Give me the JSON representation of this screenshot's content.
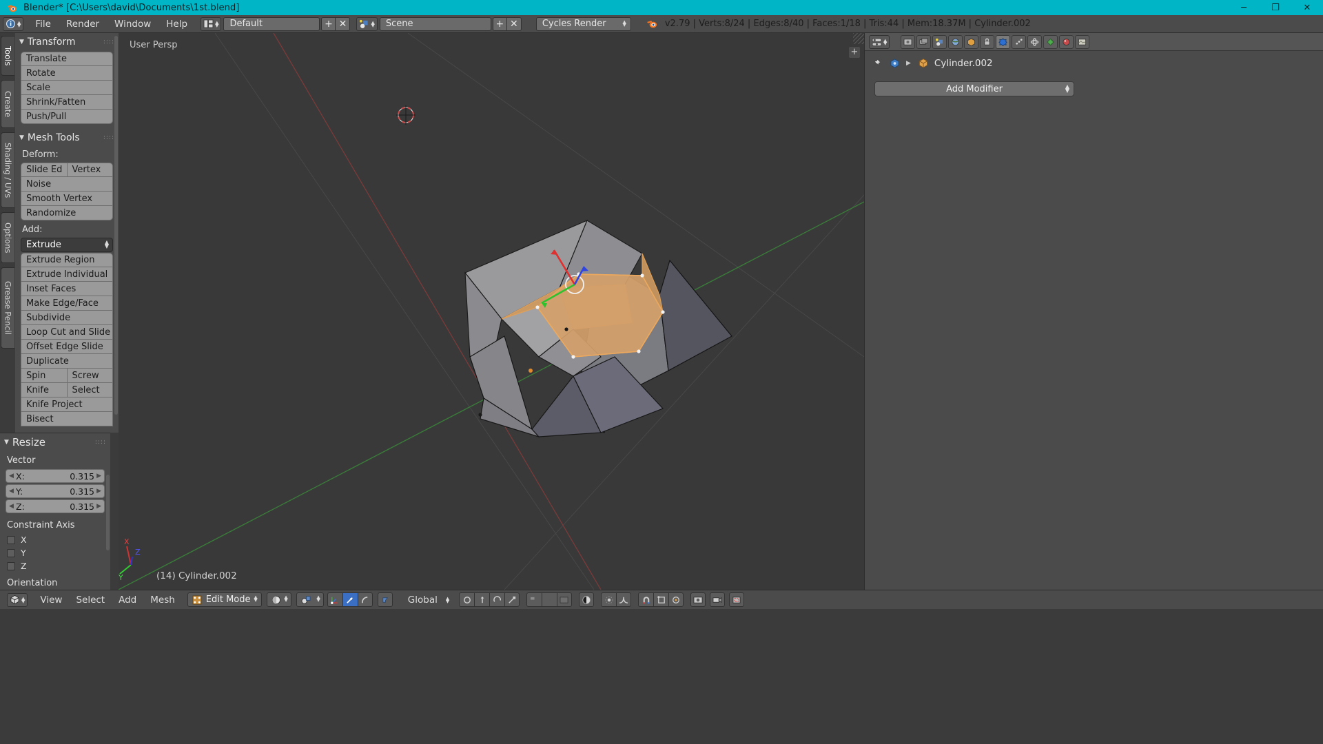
{
  "window": {
    "title": "Blender* [C:\\Users\\david\\Documents\\1st.blend]",
    "icon": "blender-logo-icon",
    "minimize": "─",
    "maximize": "❐",
    "close": "✕"
  },
  "topbar": {
    "editor_type_icon": "info-editor-icon",
    "menus": [
      "File",
      "Render",
      "Window",
      "Help"
    ],
    "screen_layout_icon": "screen-layout-icon",
    "screen_layout": "Default",
    "screen_add": "+",
    "screen_remove": "✕",
    "scene_icon": "scene-icon",
    "scene": "Scene",
    "scene_add": "+",
    "scene_remove": "✕",
    "render_engine": "Cycles Render",
    "blender_icon": "blender-logo-icon",
    "status": "v2.79 | Verts:8/24 | Edges:8/40 | Faces:1/18 | Tris:44 | Mem:18.37M | Cylinder.002"
  },
  "toolshelf": {
    "tabs": [
      {
        "label": "Tools",
        "active": true
      },
      {
        "label": "Create",
        "active": false
      },
      {
        "label": "Shading / UVs",
        "active": false
      },
      {
        "label": "Options",
        "active": false
      },
      {
        "label": "Grease Pencil",
        "active": false
      }
    ],
    "transform": {
      "title": "Transform",
      "buttons": [
        "Translate",
        "Rotate",
        "Scale",
        "Shrink/Fatten",
        "Push/Pull"
      ]
    },
    "mesh_tools": {
      "title": "Mesh Tools",
      "deform_label": "Deform:",
      "deform_pair": [
        "Slide Ed",
        "Vertex"
      ],
      "deform_buttons": [
        "Noise",
        "Smooth Vertex",
        "Randomize"
      ],
      "add_label": "Add:",
      "add_dropdown": "Extrude",
      "add_buttons": [
        "Extrude Region",
        "Extrude Individual",
        "Inset Faces",
        "Make Edge/Face",
        "Subdivide",
        "Loop Cut and Slide",
        "Offset Edge Slide",
        "Duplicate"
      ],
      "pair_spin": [
        "Spin",
        "Screw"
      ],
      "pair_knife": [
        "Knife",
        "Select"
      ],
      "tail_buttons": [
        "Knife Project",
        "Bisect"
      ]
    }
  },
  "operator_panel": {
    "title": "Resize",
    "vector_label": "Vector",
    "fields": [
      {
        "label": "X:",
        "value": "0.315"
      },
      {
        "label": "Y:",
        "value": "0.315"
      },
      {
        "label": "Z:",
        "value": "0.315"
      }
    ],
    "constraint_axis_label": "Constraint Axis",
    "axes": [
      "X",
      "Y",
      "Z"
    ],
    "orientation_label": "Orientation"
  },
  "viewport": {
    "perspective_label": "User Persp",
    "object_label": "(14) Cylinder.002",
    "axis_gizmo": {
      "x": "X",
      "y": "Y",
      "z": "Z"
    },
    "add_overlay": "+",
    "colors": {
      "background": "#393939",
      "grid": "#4c4c4c",
      "axis_x": "#9c3131",
      "axis_y": "#3c8a3c",
      "selected_face": "#d39b5e",
      "active_edge": "#e8a25c",
      "manipulator_x": "#e03030",
      "manipulator_y": "#30c030",
      "manipulator_z": "#3040e0"
    }
  },
  "properties": {
    "tabs": [
      "render-icon",
      "render-layers-icon",
      "scene-icon",
      "world-icon",
      "object-icon",
      "modifier-icon",
      "particles-icon",
      "physics-icon",
      "constraints-icon",
      "data-icon",
      "material-icon",
      "texture-icon"
    ],
    "pin_icon": "pin-icon",
    "browse_icon": "browse-object-icon",
    "chevron": "▶",
    "object_icon": "mesh-object-icon",
    "object_name": "Cylinder.002",
    "add_modifier": "Add Modifier"
  },
  "bottombar": {
    "editor_icon": "3d-view-editor-icon",
    "menus": [
      "View",
      "Select",
      "Add",
      "Mesh"
    ],
    "mode_icon": "edit-mode-icon",
    "mode": "Edit Mode",
    "shading_icon": "solid-shading-icon",
    "pivot_icon": "pivot-median-icon",
    "select_modes": [
      {
        "name": "vertex-select-icon",
        "active": false
      },
      {
        "name": "edge-select-icon",
        "active": true
      },
      {
        "name": "face-select-icon",
        "active": false
      }
    ],
    "occlude_icon": "occlude-geometry-icon",
    "orientation": "Global",
    "extra_icons": [
      "manipulator-icon",
      "translate-manipulator-icon",
      "rotate-manipulator-icon",
      "scale-manipulator-icon",
      "layers-icon",
      "proportional-edit-icon",
      "falloff-icon",
      "snap-magnet-icon",
      "snap-target-icon",
      "render-preview-icon",
      "lock-camera-icon",
      "render-region-icon",
      "camera-icon"
    ]
  }
}
